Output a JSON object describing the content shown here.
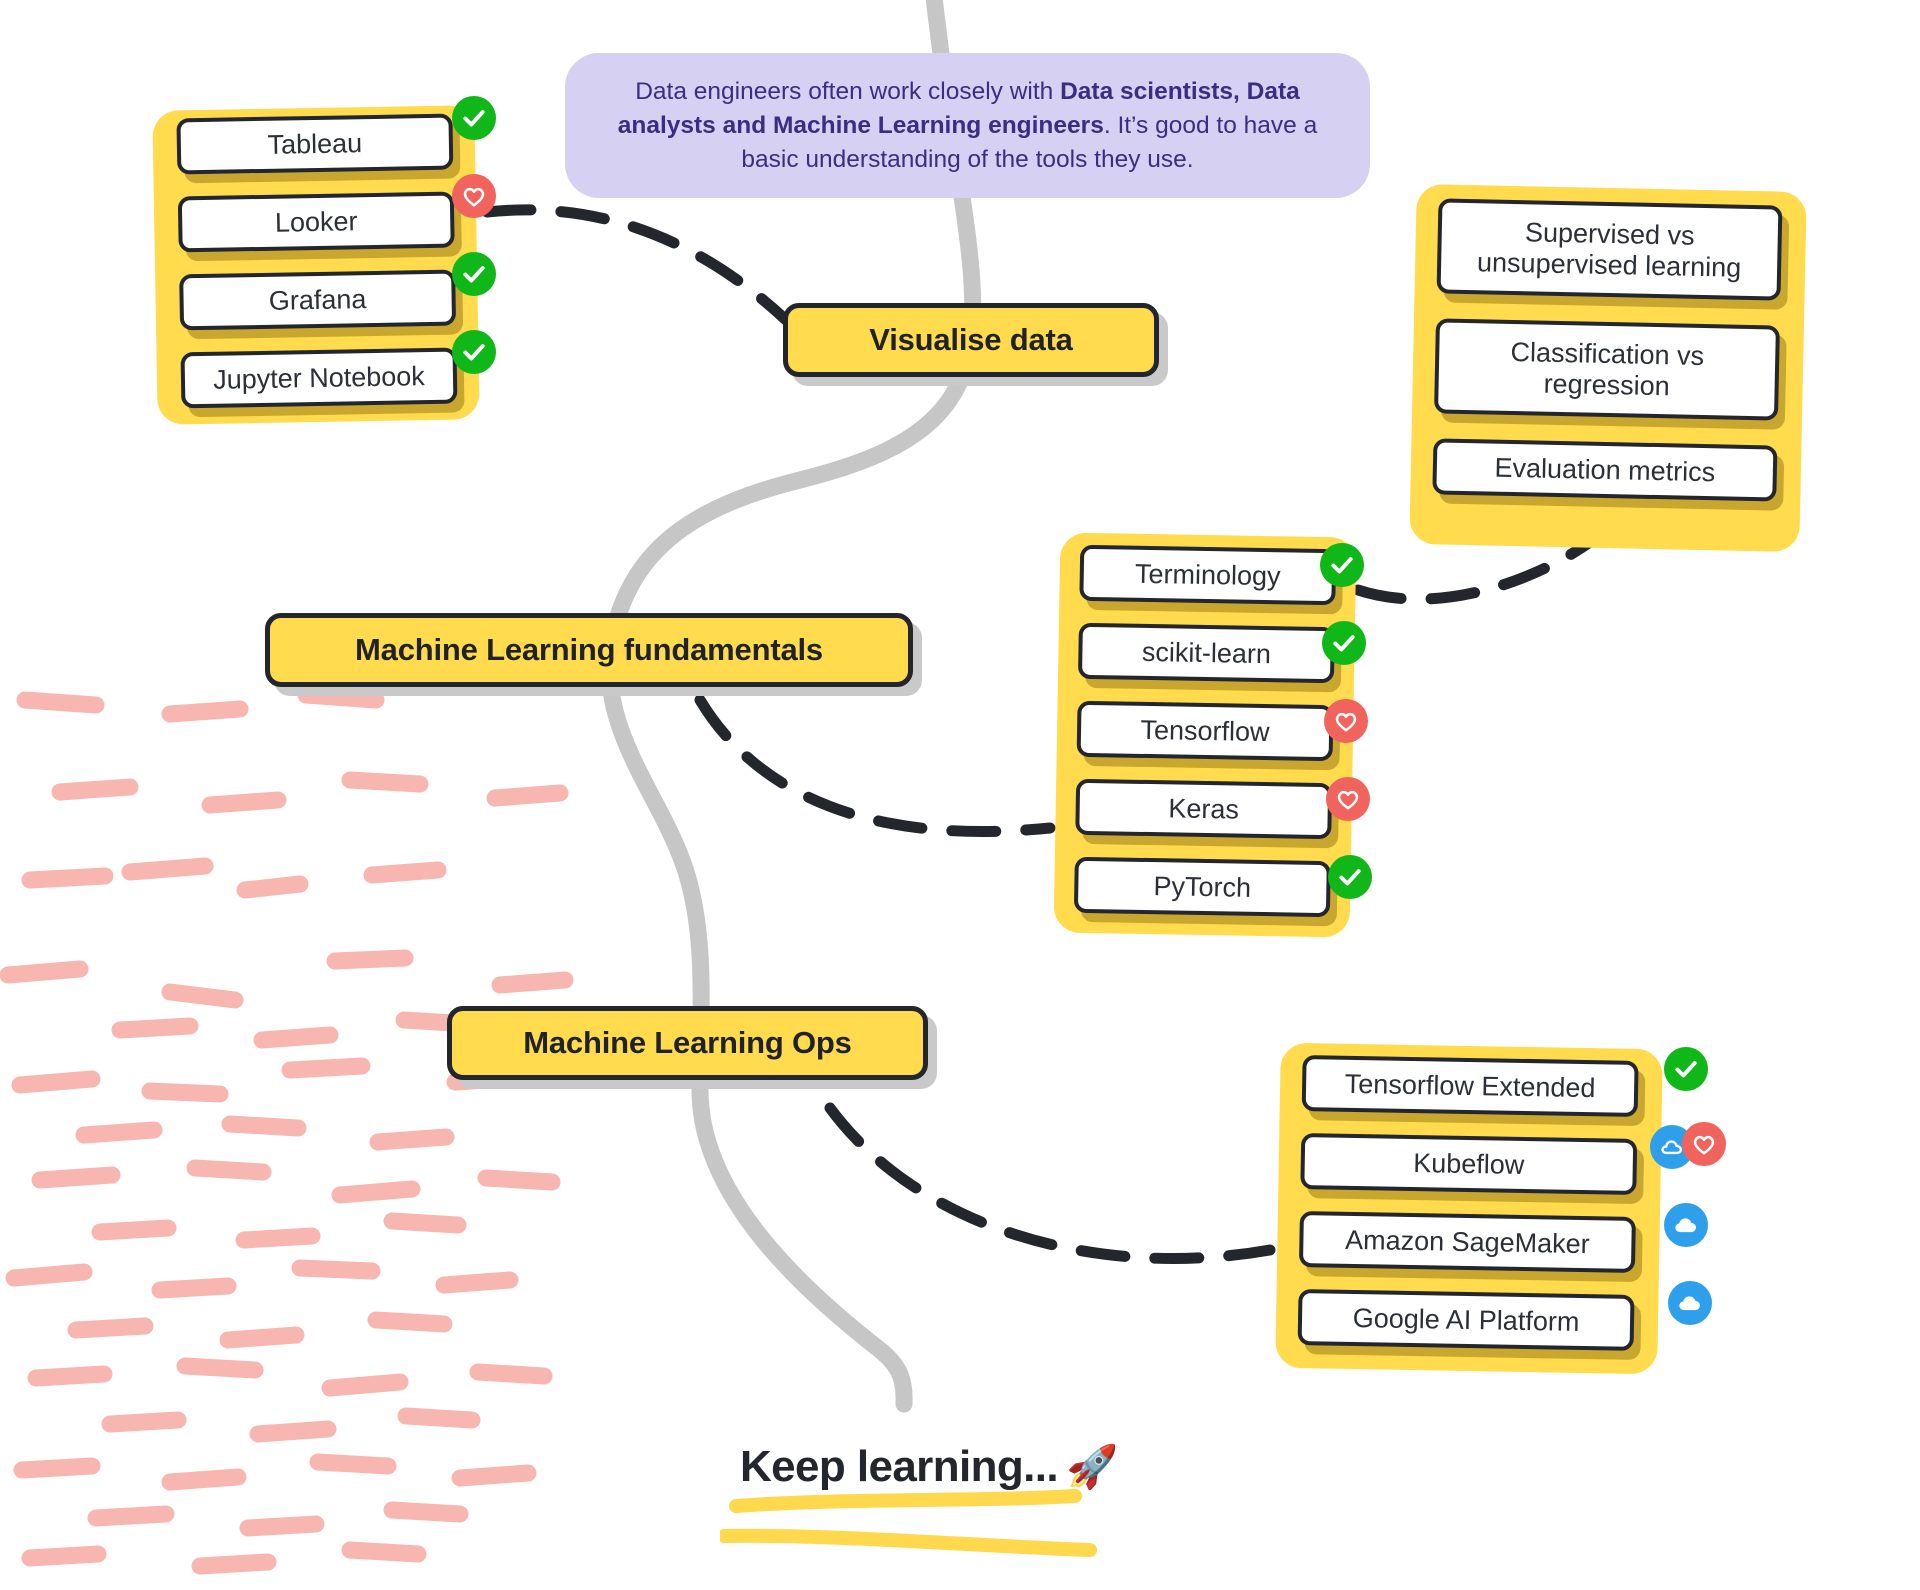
{
  "theme": {
    "page_bg": "#ffffff",
    "node_yellow": "#FFDB4D",
    "cluster_yellow": "#FFDB4D",
    "card_white": "#ffffff",
    "card_shadow_olive": "#C9A62E",
    "node_shadow_grey": "#C9C9C9",
    "outline_black": "#23262D",
    "spine_grey": "#C6C6C6",
    "connector_black": "#23262D",
    "note_bg": "#D6D1F2",
    "note_text": "#3B2D82",
    "badge_check_green": "#10B718",
    "badge_heart_red": "#F1645E",
    "badge_cloud_blue": "#2E9FEA",
    "decor_pink": "#F7B6B0",
    "underline_yellow": "#FFD84D"
  },
  "note": {
    "text_part1": "Data engineers often work closely with ",
    "text_bold": "Data scientists, Data analysts and Machine Learning engineers",
    "text_part2": ". It’s good to have a basic understanding of the tools they use."
  },
  "topics": [
    {
      "id": "visualise-data",
      "label": "Visualise data"
    },
    {
      "id": "ml-fundamentals",
      "label": "Machine Learning fundamentals"
    },
    {
      "id": "ml-ops",
      "label": "Machine Learning Ops"
    }
  ],
  "clusters": [
    {
      "id": "visualisation-tools",
      "parent": "visualise-data",
      "cards": [
        {
          "label": "Tableau",
          "badge": "check-icon"
        },
        {
          "label": "Looker",
          "badge": "heart-icon"
        },
        {
          "label": "Grafana",
          "badge": "check-icon"
        },
        {
          "label": "Jupyter Notebook",
          "badge": "check-icon"
        }
      ]
    },
    {
      "id": "ml-concepts",
      "parent": "ml-fundamentals",
      "cards": [
        {
          "label": "Supervised vs unsupervised learning",
          "badge": null
        },
        {
          "label": "Classification vs regression",
          "badge": null
        },
        {
          "label": "Evaluation metrics",
          "badge": null
        }
      ]
    },
    {
      "id": "ml-libraries",
      "parent": "ml-fundamentals",
      "cards": [
        {
          "label": "Terminology",
          "badge": "check-icon"
        },
        {
          "label": "scikit-learn",
          "badge": "check-icon"
        },
        {
          "label": "Tensorflow",
          "badge": "heart-icon"
        },
        {
          "label": "Keras",
          "badge": "heart-icon"
        },
        {
          "label": "PyTorch",
          "badge": "check-icon"
        }
      ]
    },
    {
      "id": "mlops-tools",
      "parent": "ml-ops",
      "cards": [
        {
          "label": "Tensorflow Extended",
          "badge": "check-icon"
        },
        {
          "label": "Kubeflow",
          "badge": "cloud-icon",
          "badge2": "heart-icon"
        },
        {
          "label": "Amazon SageMaker",
          "badge": "cloud-icon"
        },
        {
          "label": "Google AI Platform",
          "badge": "cloud-icon"
        }
      ]
    }
  ],
  "footer": {
    "keep_learning": "Keep learning...",
    "rocket": "🚀"
  }
}
